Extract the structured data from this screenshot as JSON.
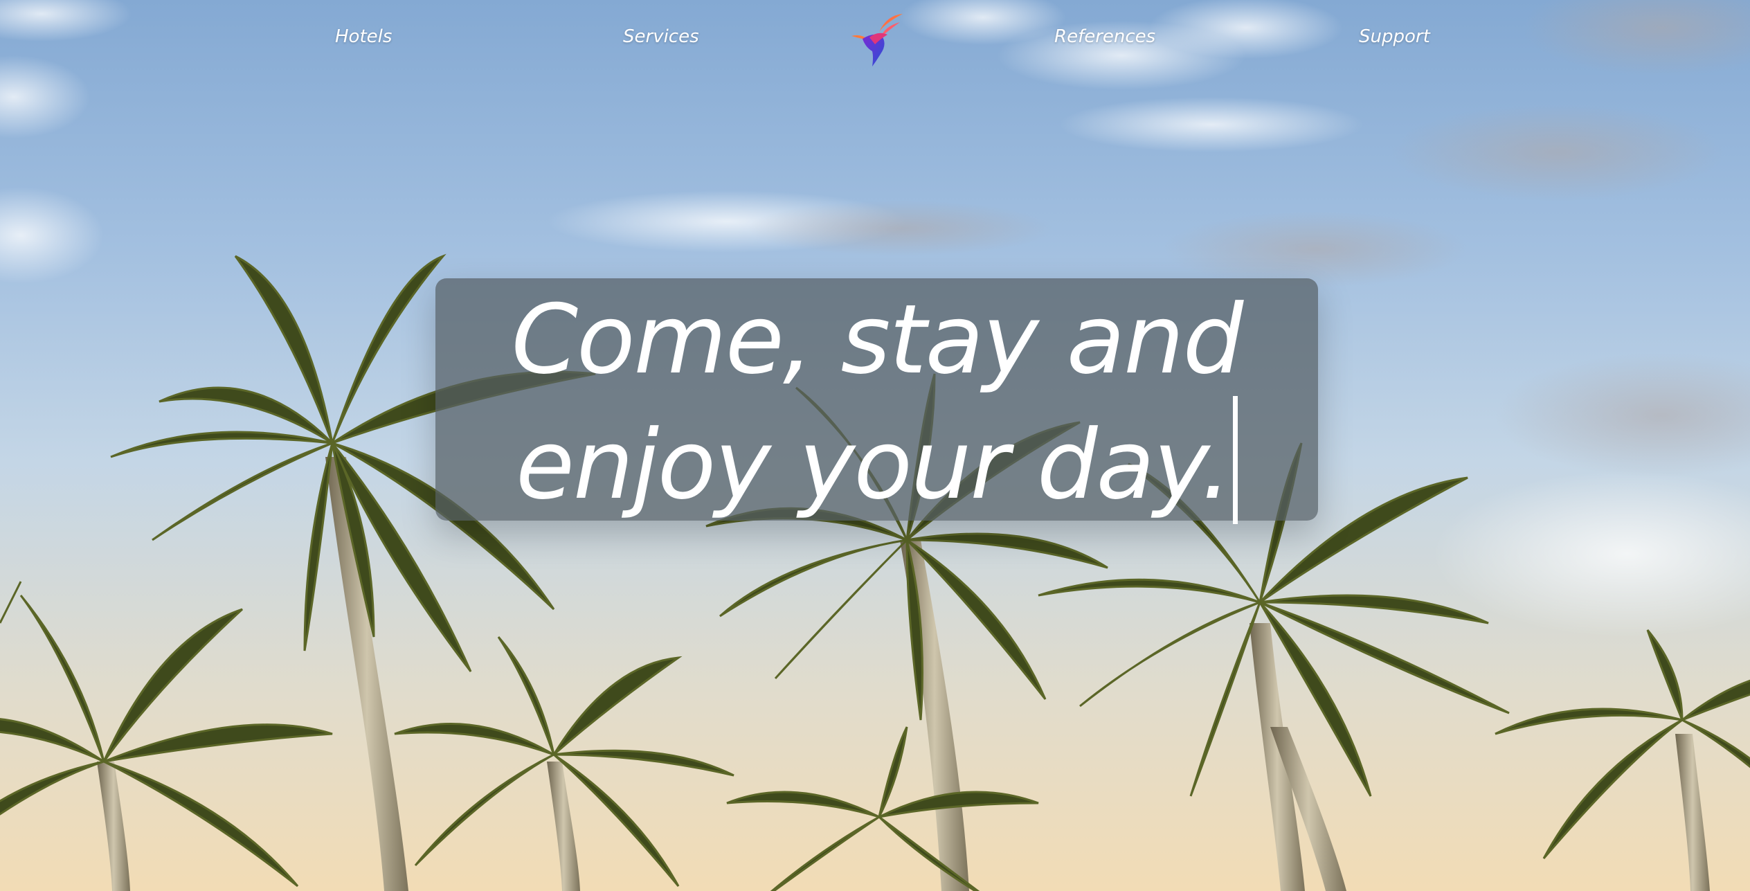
{
  "nav": {
    "items": [
      {
        "label": "Hotels"
      },
      {
        "label": "Services"
      },
      {
        "label": "References"
      },
      {
        "label": "Support"
      }
    ],
    "logo_icon": "bird-logo-icon"
  },
  "hero": {
    "line1": "Come, stay and",
    "line2": "enjoy your day."
  },
  "colors": {
    "sky_top": "#84a9d3",
    "sky_bottom": "#f2dcb5",
    "overlay": "#555e64",
    "logo_gradient": [
      "#ff3d7f",
      "#ff8a2b",
      "#7a2bd4",
      "#2b4fd4"
    ]
  }
}
